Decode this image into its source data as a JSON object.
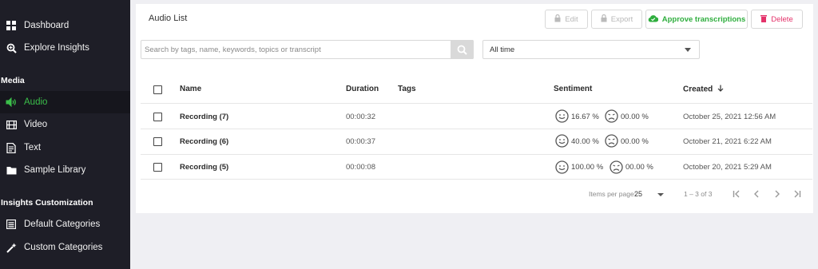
{
  "sidebar": {
    "items_top": [
      {
        "label": "Dashboard",
        "icon": "dashboard-icon"
      },
      {
        "label": "Explore Insights",
        "icon": "search-insights-icon"
      }
    ],
    "section_media": "Media",
    "media_items": [
      {
        "label": "Audio",
        "icon": "audio-icon",
        "active": true
      },
      {
        "label": "Video",
        "icon": "video-icon"
      },
      {
        "label": "Text",
        "icon": "text-icon"
      },
      {
        "label": "Sample Library",
        "icon": "folder-icon"
      }
    ],
    "section_custom": "Insights Customization",
    "custom_items": [
      {
        "label": "Default Categories",
        "icon": "list-icon"
      },
      {
        "label": "Custom Categories",
        "icon": "magic-wand-icon"
      }
    ]
  },
  "main": {
    "title": "Audio List",
    "toolbar": {
      "edit": "Edit",
      "export": "Export",
      "approve": "Approve transcriptions",
      "delete": "Delete"
    },
    "search_placeholder": "Search by tags, name, keywords, topics or transcript",
    "time_filter": "All time",
    "columns": {
      "name": "Name",
      "duration": "Duration",
      "tags": "Tags",
      "sentiment": "Sentiment",
      "created": "Created"
    },
    "rows": [
      {
        "name": "Recording (7)",
        "duration": "00:00:32",
        "tags": "",
        "positive": "16.67 %",
        "negative": "00.00 %",
        "created": "October 25, 2021 12:56 AM"
      },
      {
        "name": "Recording (6)",
        "duration": "00:00:37",
        "tags": "",
        "positive": "40.00 %",
        "negative": "00.00 %",
        "created": "October 21, 2021 6:22 AM"
      },
      {
        "name": "Recording (5)",
        "duration": "00:00:08",
        "tags": "",
        "positive": "100.00 %",
        "negative": "00.00 %",
        "created": "October 20, 2021 5:29 AM"
      }
    ],
    "pagination": {
      "items_per_page_label": "Items per page:",
      "items_per_page": "25",
      "range": "1 – 3 of 3"
    }
  },
  "colors": {
    "sidebar_bg": "#1e1e27",
    "accent_green": "#3bbf4a",
    "delete_pink": "#e4326a",
    "page_bg": "#efeff3"
  }
}
